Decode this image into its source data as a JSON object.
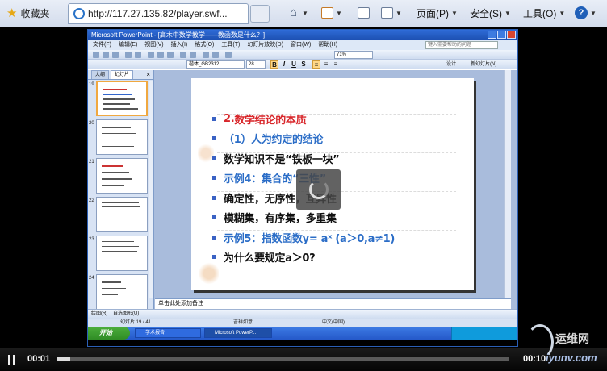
{
  "browser": {
    "favorites_label": "收藏夹",
    "tab_title": "http://117.27.135.82/player.swf...",
    "commands": {
      "page": "页面(P)",
      "safety": "安全(S)",
      "tools": "工具(O)"
    },
    "icons": [
      "home-icon",
      "rss-icon",
      "mail-icon",
      "print-icon",
      "help-icon"
    ]
  },
  "ppt": {
    "window_title": "Microsoft PowerPoint - [高木中数学教学——教函数是什么？]",
    "menu": [
      "文件(F)",
      "编辑(E)",
      "视图(V)",
      "插入(I)",
      "格式(O)",
      "工具(T)",
      "幻灯片放映(D)",
      "窗口(W)",
      "帮助(H)"
    ],
    "help_placeholder": "键入需要帮助的问题",
    "zoom": "71%",
    "font_name": "楷体_GB2312",
    "font_size": "28",
    "design_label": "设计",
    "new_slide_label": "新幻灯片(N)",
    "pane_tabs": [
      "大纲",
      "幻灯片"
    ],
    "slide_numbers": [
      "19",
      "20",
      "21",
      "22",
      "23",
      "24"
    ],
    "selected_slide": "19",
    "slide": {
      "bullets": [
        {
          "num": "2.",
          "text": "数学结论的本质",
          "style": "red"
        },
        {
          "text": "（1）人为约定的结论",
          "style": "blue"
        },
        {
          "text": "数学知识不是“铁板一块”",
          "style": "black"
        },
        {
          "text": "示例4：集合的“三性”",
          "style": "blue"
        },
        {
          "text": "确定性，无序性，互异性",
          "style": "black"
        },
        {
          "text": "模糊集，有序集，多重集",
          "style": "black"
        },
        {
          "text": "示例5：指数函数y= aˣ (a＞0,a≠1)",
          "style": "blue"
        },
        {
          "text": "为什么要规定a＞0?",
          "style": "black"
        }
      ]
    },
    "notes_text": "单击此处添加备注",
    "draw_label": "绘图(R)",
    "autoshapes_label": "自选图形(U)",
    "status": {
      "slide": "幻灯片 19 / 41",
      "design": "吉祥如意",
      "language": "中文(中国)"
    },
    "taskbar": {
      "start": "开始",
      "items": [
        "学术报告",
        "Microsoft PowerP..."
      ]
    }
  },
  "player": {
    "current_time": "00:01",
    "duration": "00:10",
    "progress": 0.03
  },
  "watermark": {
    "title": "运维网",
    "site": "iyunv.com"
  },
  "colors": {
    "accent_red": "#d8262a",
    "accent_blue": "#2b6dc7",
    "ppt_blue": "#1c4fb0"
  }
}
